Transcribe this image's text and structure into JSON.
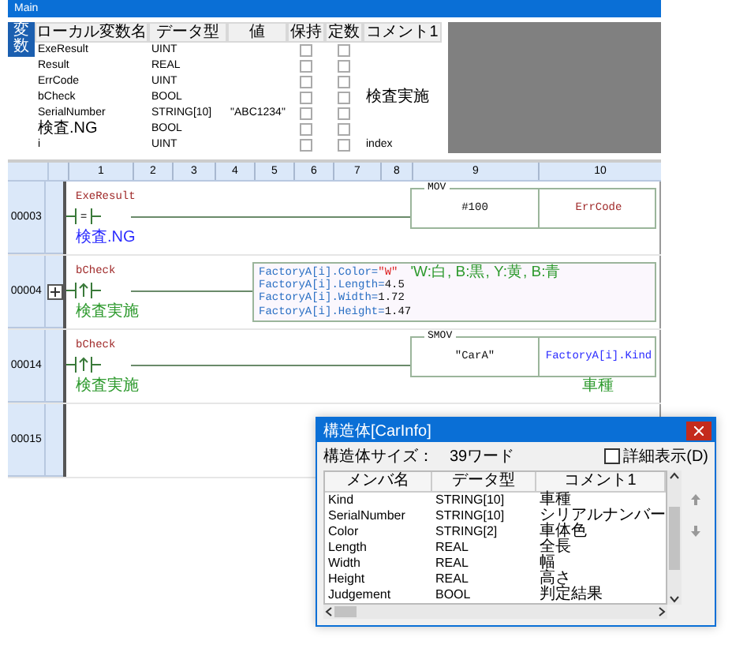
{
  "window": {
    "title": "Main"
  },
  "variables_tab": {
    "label": "変数",
    "selected": true
  },
  "variables": {
    "columns": [
      "ローカル変数名",
      "データ型",
      "値",
      "保持",
      "定数",
      "コメント1"
    ],
    "rows": [
      {
        "name": "ExeResult",
        "type": "UINT",
        "retain": false,
        "constant": false
      },
      {
        "name": "Result",
        "type": "REAL",
        "retain": false,
        "constant": false
      },
      {
        "name": "ErrCode",
        "type": "UINT",
        "retain": false,
        "constant": false
      },
      {
        "name": "bCheck",
        "type": "BOOL",
        "retain": false,
        "constant": false,
        "comment": "検査実施"
      },
      {
        "name": "SerialNumber",
        "type": "STRING[10]",
        "value": "\"ABC1234\"",
        "retain": false,
        "constant": false
      },
      {
        "name": "検査.NG",
        "type": "BOOL",
        "retain": false,
        "constant": false
      },
      {
        "name": "i",
        "type": "UINT",
        "retain": false,
        "constant": false,
        "comment": "index"
      }
    ]
  },
  "ladder": {
    "columns": [
      "1",
      "2",
      "3",
      "4",
      "5",
      "6",
      "7",
      "8",
      "9",
      "10"
    ],
    "rungs": [
      {
        "number": "00003",
        "expandable": false,
        "contact": {
          "kind": "normal",
          "label": "ExeResult",
          "symbol": "=",
          "comment": {
            "text": "検査.NG",
            "kind": "device"
          }
        },
        "instruction": {
          "kind": "function",
          "name": "MOV",
          "operands": [
            {
              "text": "#100",
              "kind": "constant"
            },
            {
              "text": "ErrCode",
              "kind": "variable"
            }
          ]
        }
      },
      {
        "number": "00004",
        "expandable": true,
        "contact": {
          "kind": "rising",
          "label": "bCheck",
          "comment": {
            "text": "検査実施",
            "kind": "label"
          }
        },
        "instruction": {
          "kind": "st",
          "lines": [
            {
              "target": "FactoryA[i].Color",
              "op": "=",
              "value": {
                "text": "\"W\"",
                "kind": "string"
              },
              "comment": "'W:白, B:黒, Y:黄, B:青"
            },
            {
              "target": "FactoryA[i].Length",
              "op": "=",
              "value": {
                "text": "4.5",
                "kind": "number"
              }
            },
            {
              "target": "FactoryA[i].Width",
              "op": "=",
              "value": {
                "text": "1.72",
                "kind": "number"
              }
            },
            {
              "target": "FactoryA[i].Height",
              "op": "=",
              "value": {
                "text": "1.47",
                "kind": "number"
              }
            }
          ]
        }
      },
      {
        "number": "00014",
        "expandable": false,
        "contact": {
          "kind": "rising",
          "label": "bCheck",
          "comment": {
            "text": "検査実施",
            "kind": "label"
          }
        },
        "instruction": {
          "kind": "function",
          "name": "SMOV",
          "operands": [
            {
              "text": "\"CarA\"",
              "kind": "constant"
            },
            {
              "text": "FactoryA[i].Kind",
              "kind": "member",
              "comment": "車種"
            }
          ]
        }
      },
      {
        "number": "00015",
        "expandable": false
      }
    ]
  },
  "struct_dialog": {
    "title": "構造体[CarInfo]",
    "size_label": "構造体サイズ：",
    "size_value": "39ワード",
    "detail_checkbox": {
      "label": "詳細表示(D)",
      "checked": false
    },
    "columns": [
      "メンバ名",
      "データ型",
      "コメント1"
    ],
    "rows": [
      {
        "name": "Kind",
        "type": "STRING[10]",
        "comment": "車種"
      },
      {
        "name": "SerialNumber",
        "type": "STRING[10]",
        "comment": "シリアルナンバー"
      },
      {
        "name": "Color",
        "type": "STRING[2]",
        "comment": "車体色"
      },
      {
        "name": "Length",
        "type": "REAL",
        "comment": "全長"
      },
      {
        "name": "Width",
        "type": "REAL",
        "comment": "幅"
      },
      {
        "name": "Height",
        "type": "REAL",
        "comment": "高さ"
      },
      {
        "name": "Judgement",
        "type": "BOOL",
        "comment": "判定結果"
      }
    ]
  }
}
